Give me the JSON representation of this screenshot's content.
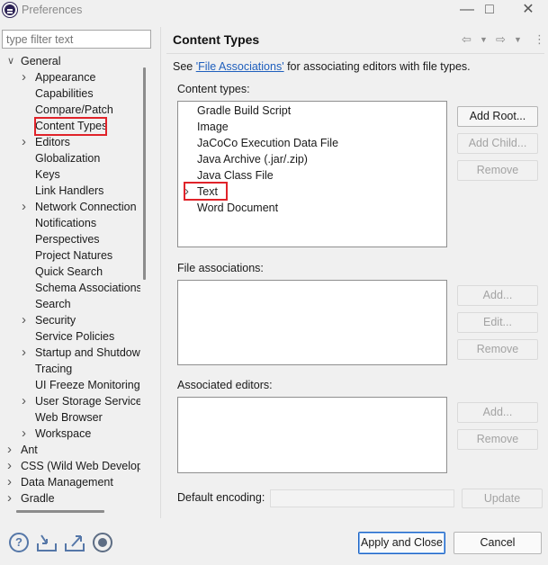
{
  "window": {
    "title": "Preferences"
  },
  "filter": {
    "placeholder": "type filter text"
  },
  "tree": [
    {
      "label": "General",
      "expanded": true
    },
    {
      "label": "Appearance",
      "expandable": true
    },
    {
      "label": "Capabilities"
    },
    {
      "label": "Compare/Patch"
    },
    {
      "label": "Content Types",
      "selected": true
    },
    {
      "label": "Editors",
      "expandable": true
    },
    {
      "label": "Globalization"
    },
    {
      "label": "Keys"
    },
    {
      "label": "Link Handlers"
    },
    {
      "label": "Network Connection",
      "expandable": true
    },
    {
      "label": "Notifications"
    },
    {
      "label": "Perspectives"
    },
    {
      "label": "Project Natures"
    },
    {
      "label": "Quick Search"
    },
    {
      "label": "Schema Associations"
    },
    {
      "label": "Search"
    },
    {
      "label": "Security",
      "expandable": true
    },
    {
      "label": "Service Policies"
    },
    {
      "label": "Startup and Shutdow",
      "expandable": true
    },
    {
      "label": "Tracing"
    },
    {
      "label": "UI Freeze Monitoring"
    },
    {
      "label": "User Storage Service",
      "expandable": true
    },
    {
      "label": "Web Browser"
    },
    {
      "label": "Workspace",
      "expandable": true
    },
    {
      "label": "Ant",
      "expandable": true
    },
    {
      "label": "CSS (Wild Web Develop",
      "expandable": true
    },
    {
      "label": "Data Management",
      "expandable": true
    },
    {
      "label": "Gradle",
      "expandable": true
    }
  ],
  "page": {
    "title": "Content Types",
    "description_prefix": "See ",
    "description_link": "'File Associations'",
    "description_suffix": " for associating editors with file types.",
    "content_types_label": "Content types:",
    "content_types": [
      {
        "label": "Gradle Build Script"
      },
      {
        "label": "Image"
      },
      {
        "label": "JaCoCo Execution Data File"
      },
      {
        "label": "Java Archive (.jar/.zip)"
      },
      {
        "label": "Java Class File"
      },
      {
        "label": "Text",
        "expandable": true,
        "highlighted": true
      },
      {
        "label": "Word Document"
      }
    ],
    "content_type_buttons": {
      "add_root": "Add Root...",
      "add_child": "Add Child...",
      "remove": "Remove"
    },
    "file_associations_label": "File associations:",
    "file_association_buttons": {
      "add": "Add...",
      "edit": "Edit...",
      "remove": "Remove"
    },
    "associated_editors_label": "Associated editors:",
    "associated_editor_buttons": {
      "add": "Add...",
      "remove": "Remove"
    },
    "default_encoding_label": "Default encoding:",
    "default_encoding_value": "",
    "update_button": "Update"
  },
  "footer": {
    "apply_close": "Apply and Close",
    "cancel": "Cancel"
  },
  "icons": {
    "help": "help-icon",
    "import": "import-icon",
    "export": "export-icon",
    "record": "record-icon"
  },
  "colors": {
    "accent": "#1b63c4",
    "link": "#1f5fbd",
    "selection_highlight": "#e0232a"
  }
}
